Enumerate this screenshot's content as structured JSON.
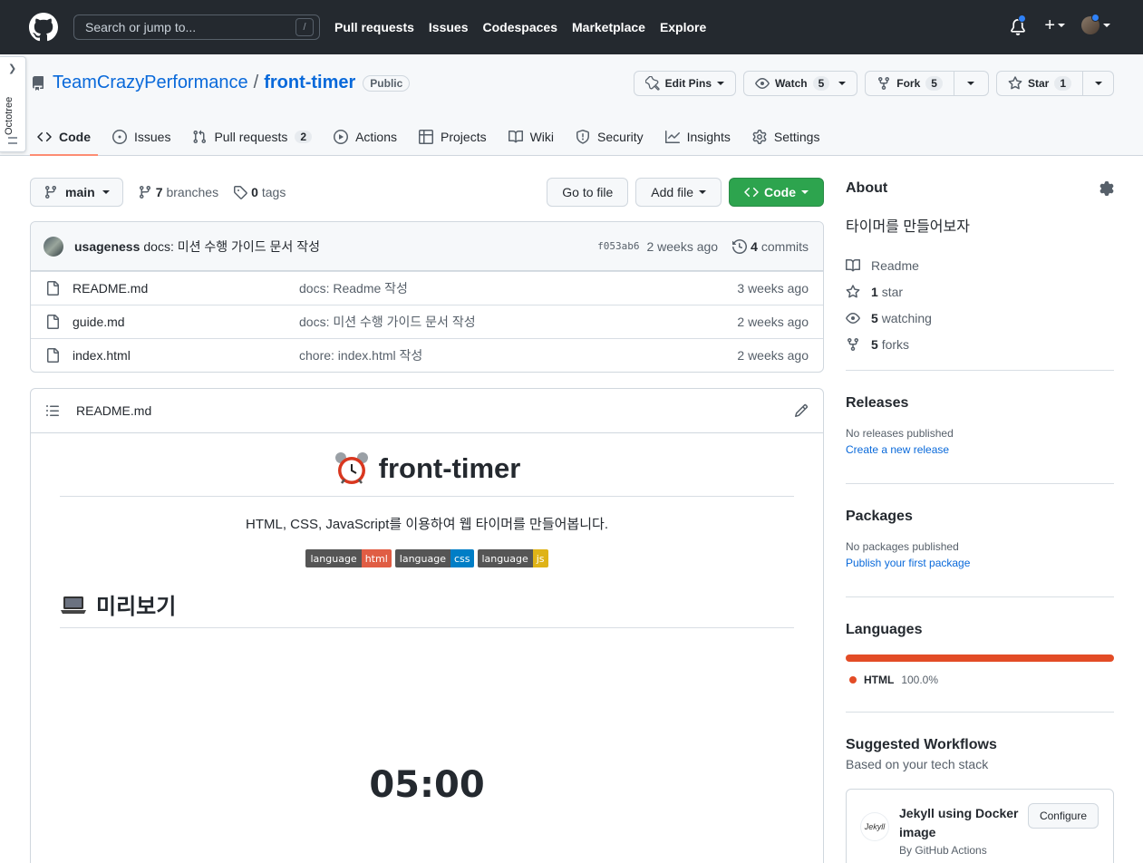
{
  "topbar": {
    "search_placeholder": "Search or jump to...",
    "search_shortcut": "/",
    "nav": [
      "Pull requests",
      "Issues",
      "Codespaces",
      "Marketplace",
      "Explore"
    ]
  },
  "octotree": {
    "label": "Octotree"
  },
  "repo": {
    "owner": "TeamCrazyPerformance",
    "separator": "/",
    "name": "front-timer",
    "visibility": "Public",
    "actions": {
      "edit_pins": "Edit Pins",
      "watch": "Watch",
      "watch_count": "5",
      "fork": "Fork",
      "fork_count": "5",
      "star": "Star",
      "star_count": "1"
    },
    "tabs": [
      {
        "label": "Code"
      },
      {
        "label": "Issues"
      },
      {
        "label": "Pull requests",
        "count": "2"
      },
      {
        "label": "Actions"
      },
      {
        "label": "Projects"
      },
      {
        "label": "Wiki"
      },
      {
        "label": "Security"
      },
      {
        "label": "Insights"
      },
      {
        "label": "Settings"
      }
    ]
  },
  "filenav": {
    "branch": "main",
    "branches_count": "7",
    "branches_label": "branches",
    "tags_count": "0",
    "tags_label": "tags",
    "go_to_file": "Go to file",
    "add_file": "Add file",
    "code": "Code"
  },
  "commit": {
    "author": "usageness",
    "message": "docs: 미션 수행 가이드 문서 작성",
    "sha": "f053ab6",
    "time": "2 weeks ago",
    "commits_count": "4",
    "commits_label": "commits"
  },
  "files": [
    {
      "name": "README.md",
      "message": "docs: Readme 작성",
      "time": "3 weeks ago"
    },
    {
      "name": "guide.md",
      "message": "docs: 미션 수행 가이드 문서 작성",
      "time": "2 weeks ago"
    },
    {
      "name": "index.html",
      "message": "chore: index.html 작성",
      "time": "2 weeks ago"
    }
  ],
  "readme": {
    "filename": "README.md",
    "title": "front-timer",
    "description": "HTML, CSS, JavaScript를 이용하여 웹 타이머를 만들어봅니다.",
    "badges": [
      {
        "label": "language",
        "value": "html",
        "color": "#e34c26"
      },
      {
        "label": "language",
        "value": "css",
        "color": "#007ec6"
      },
      {
        "label": "language",
        "value": "js",
        "color": "#dfb317"
      }
    ],
    "preview_heading": "미리보기",
    "timer": "05:00"
  },
  "about": {
    "heading": "About",
    "description": "타이머를 만들어보자",
    "readme": "Readme",
    "stars_count": "1",
    "stars_label": "star",
    "watching_count": "5",
    "watching_label": "watching",
    "forks_count": "5",
    "forks_label": "forks"
  },
  "releases": {
    "heading": "Releases",
    "empty": "No releases published",
    "link": "Create a new release"
  },
  "packages": {
    "heading": "Packages",
    "empty": "No packages published",
    "link": "Publish your first package"
  },
  "languages": {
    "heading": "Languages",
    "items": [
      {
        "name": "HTML",
        "percent": "100.0%",
        "color": "#e34c26"
      }
    ]
  },
  "workflows": {
    "heading": "Suggested Workflows",
    "subheading": "Based on your tech stack",
    "items": [
      {
        "name": "Jekyll using Docker image",
        "by": "By GitHub Actions",
        "button": "Configure",
        "logo_text": "Jekyll"
      }
    ]
  }
}
